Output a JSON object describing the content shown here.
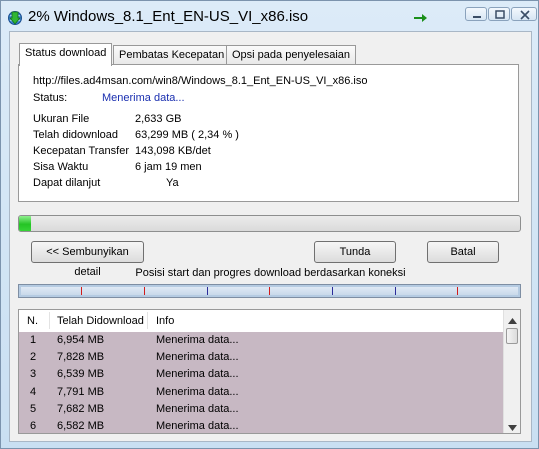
{
  "window": {
    "title": "2% Windows_8.1_Ent_EN-US_VI_x86.iso"
  },
  "tabs": [
    {
      "label": "Status download"
    },
    {
      "label": "Pembatas Kecepatan"
    },
    {
      "label": "Opsi pada penyelesaian"
    }
  ],
  "details": {
    "url": "http://files.ad4msan.com/win8/Windows_8.1_Ent_EN-US_VI_x86.iso",
    "status_label": "Status:",
    "status_value": "Menerima data...",
    "size_label": "Ukuran File",
    "size_value": "2,633  GB",
    "downloaded_label": "Telah didownload",
    "downloaded_value": "63,299  MB  ( 2,34 % )",
    "speed_label": "Kecepatan Transfer",
    "speed_value": "143,098  KB/det",
    "remaining_label": "Sisa Waktu",
    "remaining_value": "6 jam 19 men",
    "resume_label": "Dapat dilanjut",
    "resume_value": "Ya"
  },
  "progress": {
    "fraction": 0.0234
  },
  "buttons": {
    "hide_details": "<< Sembunyikan detail",
    "pause": "Tunda",
    "cancel": "Batal"
  },
  "connections": {
    "caption": "Posisi start dan progres download berdasarkan koneksi"
  },
  "table": {
    "headers": [
      "N.",
      "Telah Didownload",
      "Info"
    ],
    "rows": [
      {
        "n": "1",
        "downloaded": "6,954  MB",
        "info": "Menerima data..."
      },
      {
        "n": "2",
        "downloaded": "7,828  MB",
        "info": "Menerima data..."
      },
      {
        "n": "3",
        "downloaded": "6,539  MB",
        "info": "Menerima data..."
      },
      {
        "n": "4",
        "downloaded": "7,791  MB",
        "info": "Menerima data..."
      },
      {
        "n": "5",
        "downloaded": "7,682  MB",
        "info": "Menerima data..."
      },
      {
        "n": "6",
        "downloaded": "6,582  MB",
        "info": "Menerima data..."
      }
    ]
  },
  "icons": {
    "app": "download-globe-icon",
    "titlebar_extra": "green-arrow-icon"
  },
  "colors": {
    "progress_green": "#25c425",
    "segment_red": "#d21b1b",
    "row_highlight": "#c7b8c3",
    "status_blue": "#1a2fb0"
  }
}
